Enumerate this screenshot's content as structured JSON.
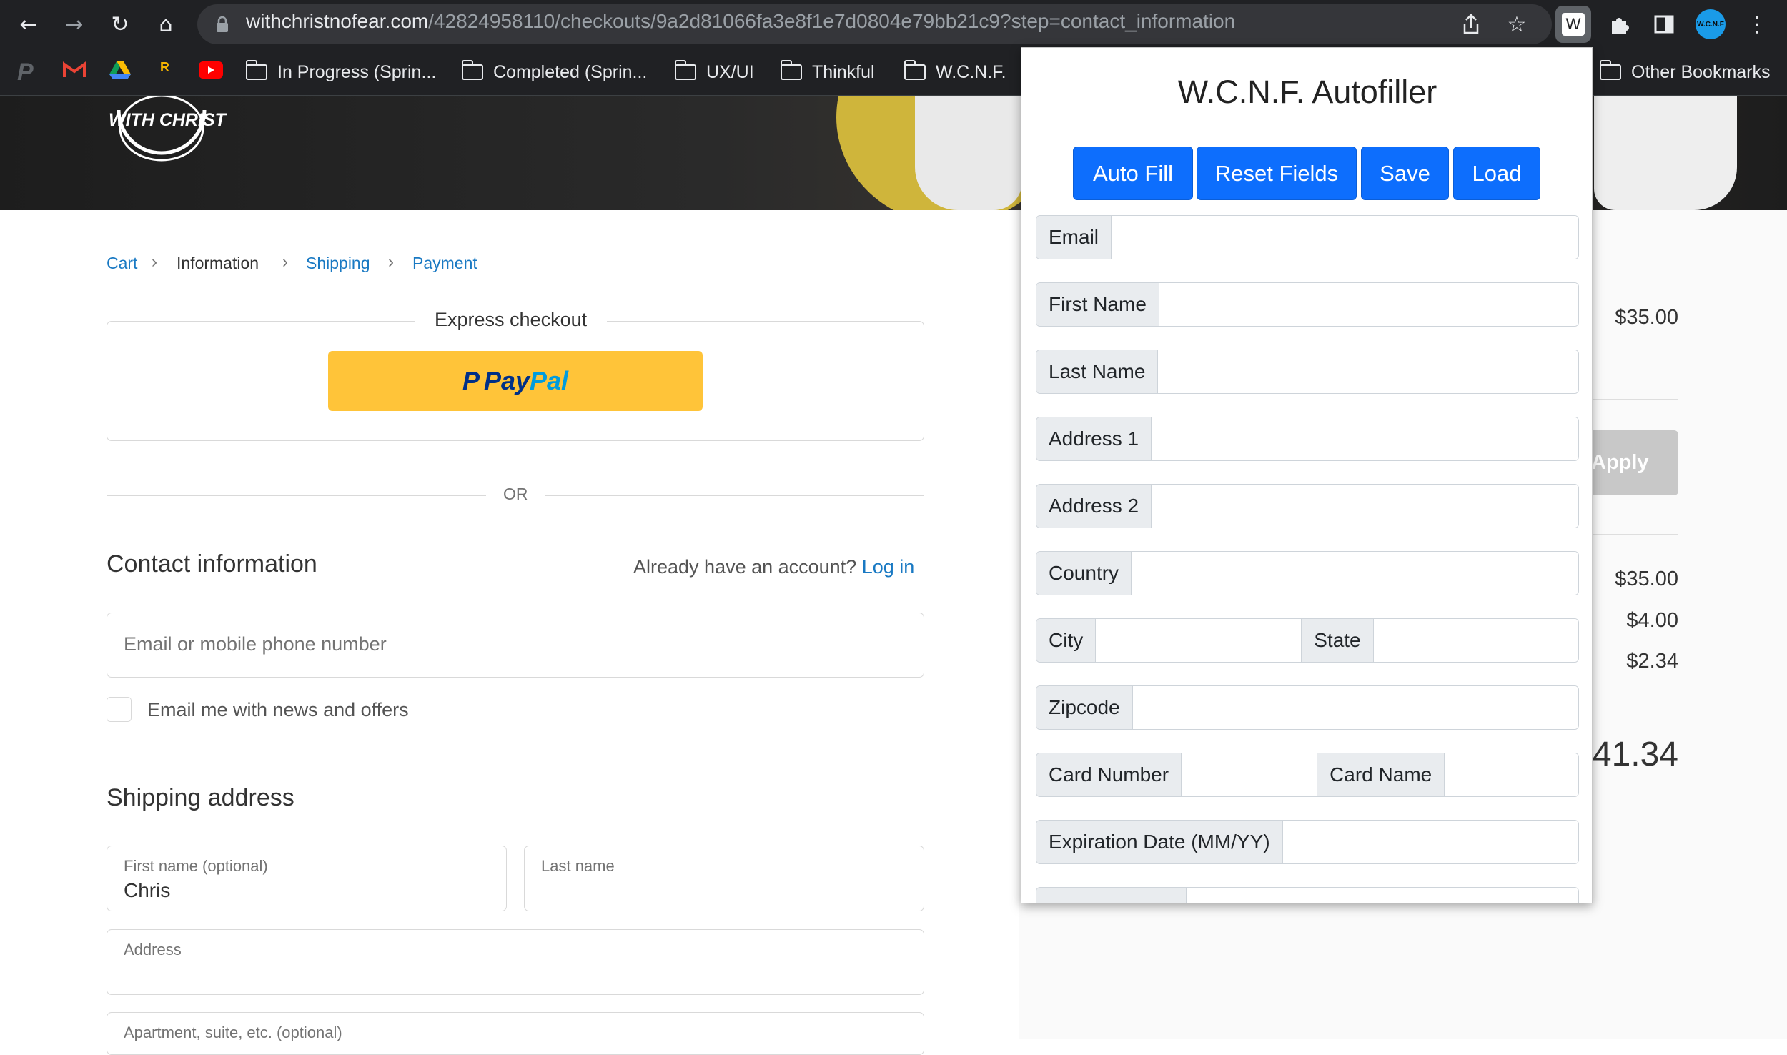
{
  "browser": {
    "url_host": "withchristnofear.com",
    "url_path": "/42824958110/checkouts/9a2d81066fa3e8f1e7d0804e79bb21c9?step=contact_information",
    "bookmarks": [
      {
        "label": "In Progress (Sprin..."
      },
      {
        "label": "Completed (Sprin..."
      },
      {
        "label": "UX/UI"
      },
      {
        "label": "Thinkful"
      },
      {
        "label": "W.C.N.F."
      }
    ],
    "other_bookmarks": "Other Bookmarks",
    "extension_badge": "W",
    "profile_badge": "W.C.N.F"
  },
  "brand": {
    "logo_text": "WITH CHRIST"
  },
  "breadcrumb": {
    "cart": "Cart",
    "information": "Information",
    "shipping": "Shipping",
    "payment": "Payment"
  },
  "express": {
    "title": "Express checkout",
    "paypal_p": "P",
    "paypal_pay": "Pay",
    "paypal_pal": "Pal",
    "or": "OR"
  },
  "contact": {
    "heading": "Contact information",
    "account_prompt": "Already have an account?",
    "login_link": "Log in",
    "email_placeholder": "Email or mobile phone number",
    "newsletter_label": "Email me with news and offers"
  },
  "shipping": {
    "heading": "Shipping address",
    "first_name_label": "First name (optional)",
    "first_name_value": "Chris",
    "last_name_label": "Last name",
    "address_label": "Address",
    "apartment_label": "Apartment, suite, etc. (optional)"
  },
  "summary": {
    "item_price": "$35.00",
    "apply_button": "Apply",
    "subtotal": "$35.00",
    "shipping": "$4.00",
    "taxes": "$2.34",
    "total": "41.34"
  },
  "autofiller": {
    "title": "W.C.N.F. Autofiller",
    "buttons": {
      "auto_fill": "Auto Fill",
      "reset": "Reset Fields",
      "save": "Save",
      "load": "Load"
    },
    "labels": {
      "email": "Email",
      "first_name": "First Name",
      "last_name": "Last Name",
      "address1": "Address 1",
      "address2": "Address 2",
      "country": "Country",
      "city": "City",
      "state": "State",
      "zipcode": "Zipcode",
      "card_number": "Card Number",
      "card_name": "Card Name",
      "expiration": "Expiration Date (MM/YY)"
    }
  },
  "colors": {
    "accent": "#1979c3",
    "popup_button": "#0d6efd",
    "paypal": "#ffc439"
  }
}
